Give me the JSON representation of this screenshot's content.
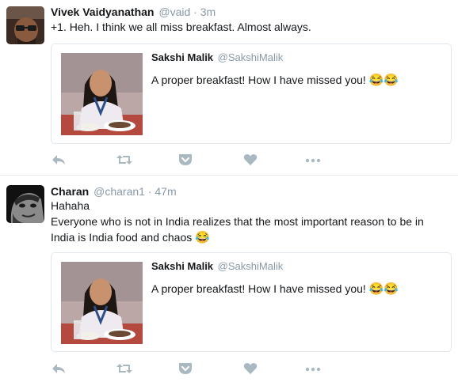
{
  "tweets": [
    {
      "author_name": "Vivek Vaidyanathan",
      "handle": "@vaid",
      "separator": "·",
      "time": "3m",
      "text_lines": [
        "+1. Heh. I think we all miss breakfast. Almost always."
      ],
      "quoted": {
        "author_name": "Sakshi Malik",
        "handle": "@SakshiMalik",
        "text": "A proper breakfast! How I have missed you!",
        "emoji": "😂😂"
      }
    },
    {
      "author_name": "Charan",
      "handle": "@charan1",
      "separator": "·",
      "time": "47m",
      "text_lines": [
        "Hahaha",
        "Everyone who is not in India realizes that the most important reason to be in",
        "India is India food and chaos"
      ],
      "text_emoji": "😂",
      "quoted": {
        "author_name": "Sakshi Malik",
        "handle": "@SakshiMalik",
        "text": "A proper breakfast! How I have missed you!",
        "emoji": "😂😂"
      }
    }
  ],
  "actions": [
    "reply-icon",
    "retweet-icon",
    "pocket-icon",
    "like-heart-icon",
    "more-dots-icon"
  ],
  "colors": {
    "icon_gray": "#aab8c2",
    "secondary_text": "#8899a6",
    "border": "#e1e8ed"
  }
}
